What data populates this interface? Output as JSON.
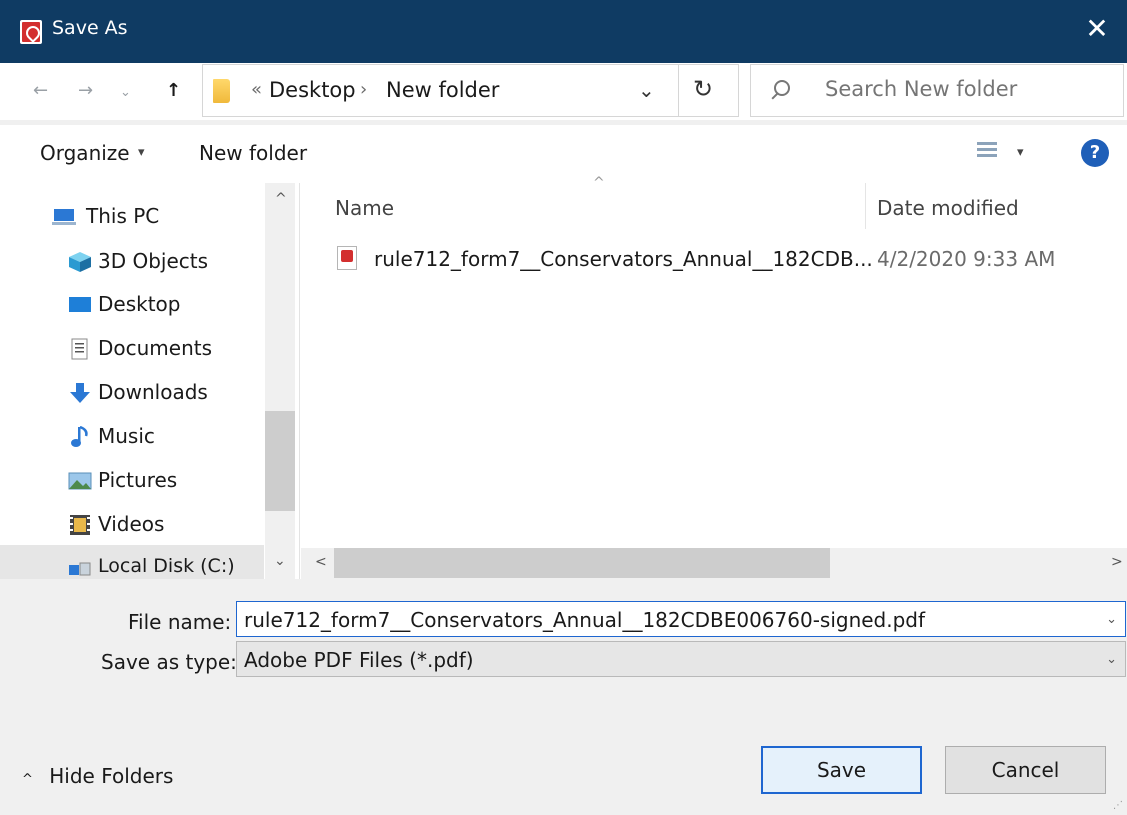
{
  "window": {
    "title": "Save As"
  },
  "nav": {
    "back": "←",
    "forward": "→",
    "recent": "⌄",
    "up": "↑",
    "breadcrumb_prefix": "«",
    "breadcrumbs": [
      "Desktop",
      "New folder"
    ],
    "separator": "›",
    "dropdown": "⌄",
    "refresh": "↻"
  },
  "search": {
    "placeholder": "Search New folder"
  },
  "toolbar": {
    "organize": "Organize",
    "organize_caret": "▾",
    "new_folder": "New folder",
    "view_caret": "▾",
    "help": "?"
  },
  "sidebar": {
    "items": [
      {
        "label": "This PC",
        "icon": "computer-icon"
      },
      {
        "label": "3D Objects",
        "icon": "cube-icon"
      },
      {
        "label": "Desktop",
        "icon": "desktop-icon"
      },
      {
        "label": "Documents",
        "icon": "documents-icon"
      },
      {
        "label": "Downloads",
        "icon": "download-arrow-icon"
      },
      {
        "label": "Music",
        "icon": "music-note-icon"
      },
      {
        "label": "Pictures",
        "icon": "picture-icon"
      },
      {
        "label": "Videos",
        "icon": "film-icon"
      },
      {
        "label": "Local Disk (C:)",
        "icon": "drive-icon"
      }
    ],
    "scroll_up": "^",
    "scroll_down": "⌄"
  },
  "file_list": {
    "headers": {
      "name": "Name",
      "date": "Date modified",
      "sort": "^"
    },
    "rows": [
      {
        "name": "rule712_form7__Conservators_Annual__182CDB...",
        "date": "4/2/2020 9:33 AM"
      }
    ],
    "scroll_left": "<",
    "scroll_right": ">"
  },
  "form": {
    "file_name_label": "File name:",
    "file_name_value": "rule712_form7__Conservators_Annual__182CDBE006760-signed.pdf",
    "save_type_label": "Save as type:",
    "save_type_value": "Adobe PDF Files (*.pdf)",
    "dropdown": "⌄"
  },
  "footer": {
    "hide_folders": "Hide Folders",
    "hide_caret": "^",
    "save": "Save",
    "cancel": "Cancel"
  },
  "colors": {
    "titlebar": "#0f3b63",
    "accent": "#1e66d0"
  }
}
